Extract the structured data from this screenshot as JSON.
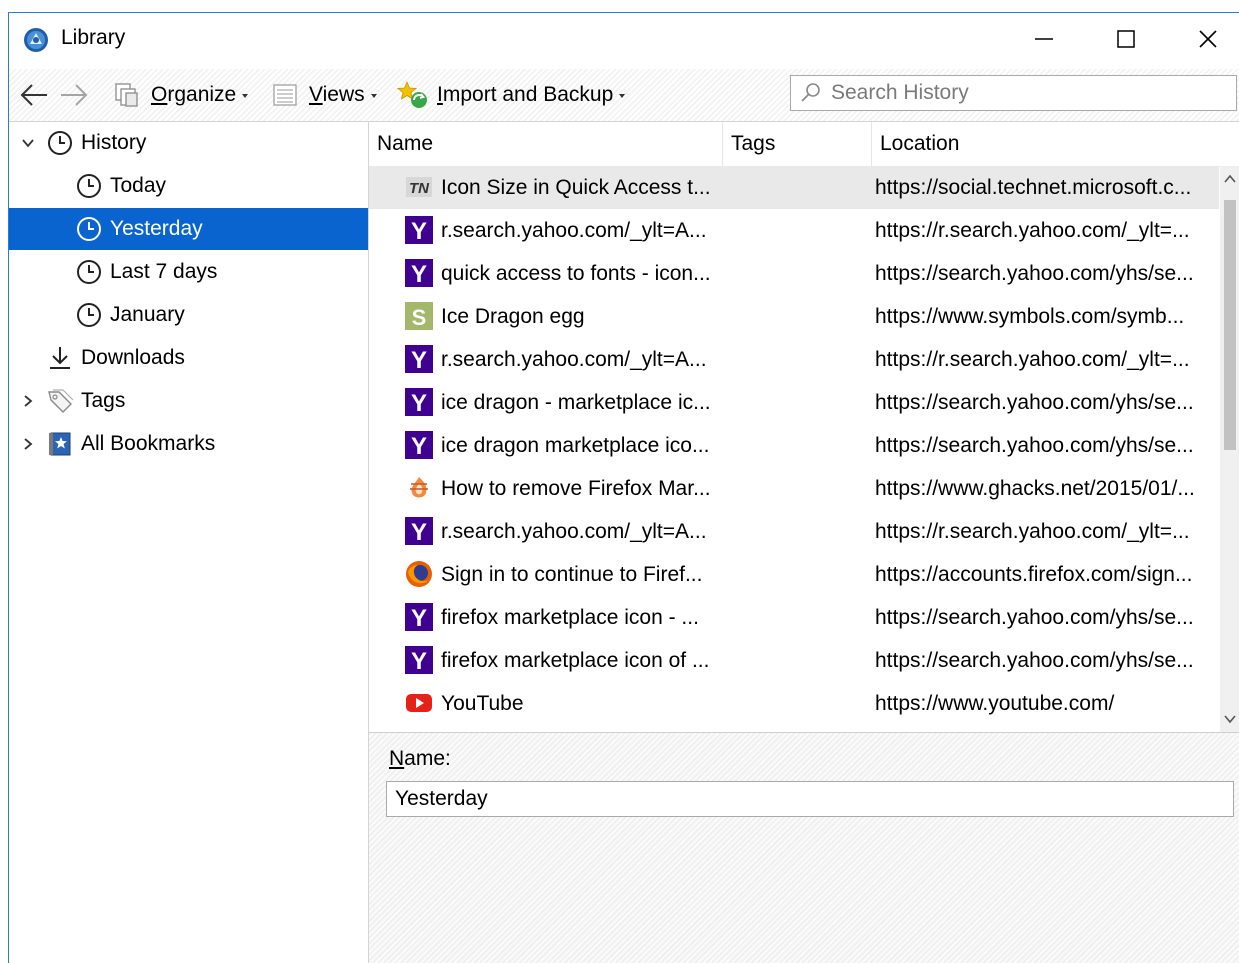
{
  "window": {
    "title": "Library",
    "controls": {
      "minimize": "minimize",
      "maximize": "maximize",
      "close": "close"
    }
  },
  "toolbar": {
    "organize_label": "Organize",
    "views_label": "Views",
    "import_label": "Import and Backup",
    "search_placeholder": "Search History"
  },
  "sidebar": {
    "items": [
      {
        "label": "History",
        "icon": "clock-icon",
        "expanded": true
      },
      {
        "label": "Today",
        "icon": "clock-icon"
      },
      {
        "label": "Yesterday",
        "icon": "clock-icon",
        "selected": true
      },
      {
        "label": "Last 7 days",
        "icon": "clock-icon"
      },
      {
        "label": "January",
        "icon": "clock-icon"
      },
      {
        "label": "Downloads",
        "icon": "download-icon"
      },
      {
        "label": "Tags",
        "icon": "tag-icon",
        "expanded": false
      },
      {
        "label": "All Bookmarks",
        "icon": "bookmarks-icon",
        "expanded": false
      }
    ]
  },
  "table": {
    "columns": [
      "Name",
      "Tags",
      "Location"
    ],
    "rows": [
      {
        "name": "Icon Size in Quick Access t...",
        "tags": "",
        "location": "https://social.technet.microsoft.c...",
        "icon": "technet-favicon"
      },
      {
        "name": "r.search.yahoo.com/_ylt=A...",
        "tags": "",
        "location": "https://r.search.yahoo.com/_ylt=...",
        "icon": "yahoo-favicon"
      },
      {
        "name": "quick access to fonts - icon...",
        "tags": "",
        "location": "https://search.yahoo.com/yhs/se...",
        "icon": "yahoo-favicon"
      },
      {
        "name": "Ice Dragon egg",
        "tags": "",
        "location": "https://www.symbols.com/symb...",
        "icon": "symbols-favicon"
      },
      {
        "name": "r.search.yahoo.com/_ylt=A...",
        "tags": "",
        "location": "https://r.search.yahoo.com/_ylt=...",
        "icon": "yahoo-favicon"
      },
      {
        "name": "ice dragon - marketplace ic...",
        "tags": "",
        "location": "https://search.yahoo.com/yhs/se...",
        "icon": "yahoo-favicon"
      },
      {
        "name": "ice dragon marketplace ico...",
        "tags": "",
        "location": "https://search.yahoo.com/yhs/se...",
        "icon": "yahoo-favicon"
      },
      {
        "name": "How to remove Firefox Mar...",
        "tags": "",
        "location": "https://www.ghacks.net/2015/01/...",
        "icon": "ghacks-favicon"
      },
      {
        "name": "r.search.yahoo.com/_ylt=A...",
        "tags": "",
        "location": "https://r.search.yahoo.com/_ylt=...",
        "icon": "yahoo-favicon"
      },
      {
        "name": "Sign in to continue to Firef...",
        "tags": "",
        "location": "https://accounts.firefox.com/sign...",
        "icon": "firefox-favicon"
      },
      {
        "name": "firefox marketplace icon - ...",
        "tags": "",
        "location": "https://search.yahoo.com/yhs/se...",
        "icon": "yahoo-favicon"
      },
      {
        "name": "firefox marketplace icon of ...",
        "tags": "",
        "location": "https://search.yahoo.com/yhs/se...",
        "icon": "yahoo-favicon"
      },
      {
        "name": "YouTube",
        "tags": "",
        "location": "https://www.youtube.com/",
        "icon": "youtube-favicon"
      }
    ]
  },
  "details": {
    "name_label": "Name:",
    "name_value": "Yesterday"
  },
  "colors": {
    "selection": "#0a64d0",
    "yahoo": "#400191",
    "youtube": "#e62117",
    "symbols": "#a3b86b"
  }
}
